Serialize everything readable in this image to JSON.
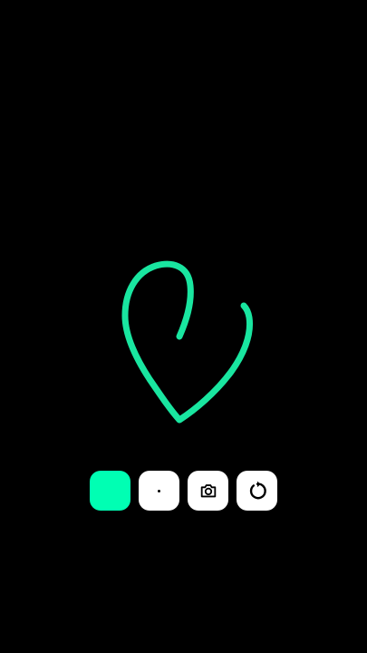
{
  "drawing": {
    "stroke_color": "#19e6a0",
    "background_color": "#000000",
    "shape": "heart-like-freehand-stroke"
  },
  "toolbar": {
    "buttons": [
      {
        "name": "color-picker-button",
        "icon": "color-swatch",
        "color": "#00ffb3"
      },
      {
        "name": "brush-size-button",
        "icon": "dot-icon"
      },
      {
        "name": "camera-button",
        "icon": "camera-icon"
      },
      {
        "name": "undo-button",
        "icon": "undo-icon"
      }
    ]
  }
}
